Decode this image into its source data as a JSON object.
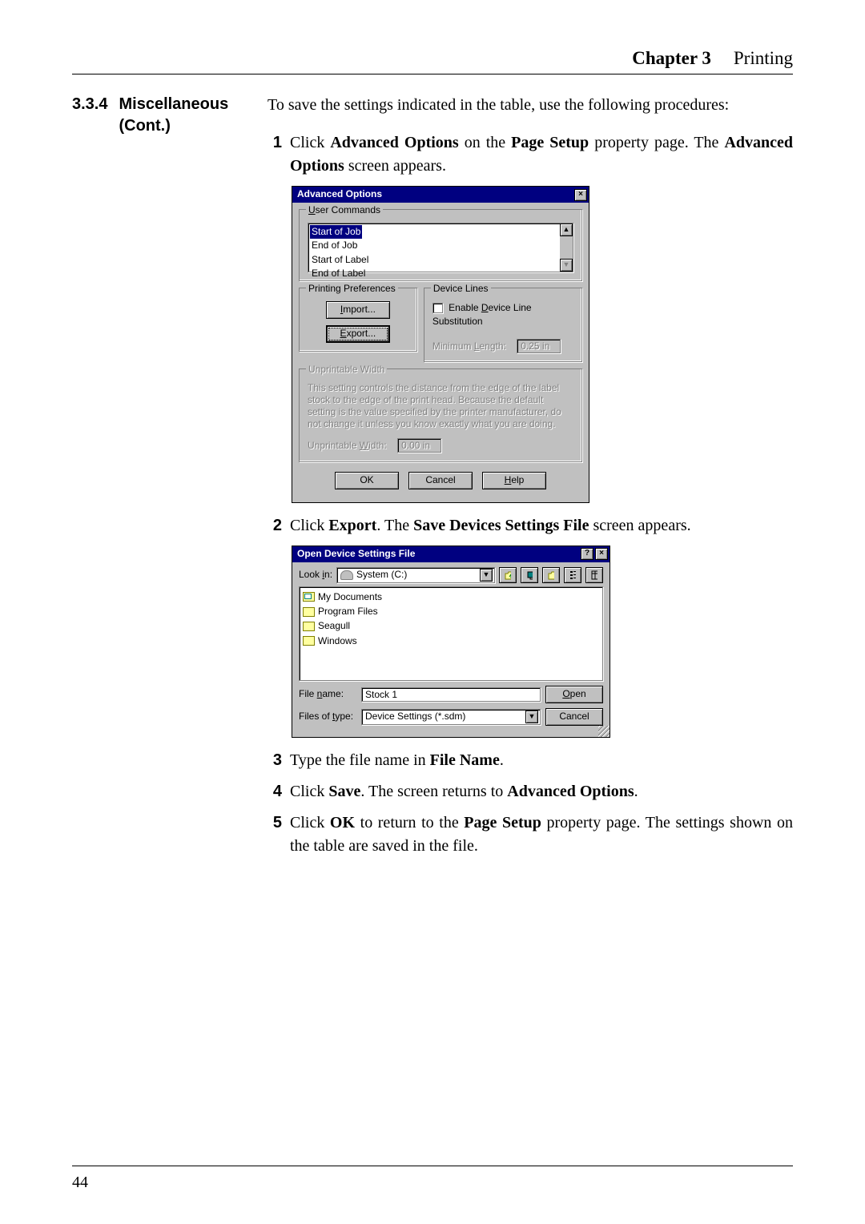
{
  "header": {
    "chapter": "Chapter 3",
    "title": "Printing"
  },
  "section": {
    "num": "3.3.4",
    "title": "Miscellaneous (Cont.)"
  },
  "intro": "To save the settings indicated in the table, use the following procedures:",
  "steps": {
    "s1": {
      "num": "1",
      "pre": "Click ",
      "b1": "Advanced Options",
      "mid": " on the ",
      "b2": "Page Setup",
      "post": " property page.  The ",
      "b3": "Advanced Options",
      "end": " screen appears."
    },
    "s2": {
      "num": "2",
      "pre": "Click ",
      "b1": "Export",
      "mid": ".  The ",
      "b2": "Save Devices Settings File",
      "end": " screen appears."
    },
    "s3": {
      "num": "3",
      "pre": "Type the file name in ",
      "b1": "File Name",
      "end": "."
    },
    "s4": {
      "num": "4",
      "pre": "Click ",
      "b1": "Save",
      "mid": ".  The screen returns to ",
      "b2": "Advanced Options",
      "end": "."
    },
    "s5": {
      "num": "5",
      "pre": "Click ",
      "b1": "OK",
      "mid": " to return to the ",
      "b2": "Page Setup",
      "end": " property page. The settings shown on the table are saved in the file."
    }
  },
  "dlg1": {
    "title": "Advanced Options",
    "close": "×",
    "grp_user": "User Commands",
    "list": {
      "sel": "Start of Job",
      "i2": "End of Job",
      "i3": "Start of Label",
      "i4": "End of Label"
    },
    "scroll_up": "▲",
    "scroll_dn": "▼",
    "grp_pref": "Printing Preferences",
    "btn_import": "Import...",
    "btn_export": "Export...",
    "grp_dev": "Device Lines",
    "chk_enable": "Enable Device Line Substitution",
    "min_len_lbl": "Minimum Length:",
    "min_len_val": "0.25 in",
    "grp_unprint": "Unprintable Width",
    "unprint_desc": "This setting controls the distance from the edge of the label stock to the edge of the print head.  Because the default setting is the value specified by the printer manufacturer, do not change it unless you know exactly what you are doing.",
    "unprint_lbl": "Unprintable Width:",
    "unprint_val": "0.00 in",
    "ok": "OK",
    "cancel": "Cancel",
    "help": "Help"
  },
  "dlg2": {
    "title": "Open Device Settings File",
    "help": "?",
    "close": "×",
    "lookin_lbl": "Look in:",
    "lookin_val": "System (C:)",
    "items": {
      "i1": "My Documents",
      "i2": "Program Files",
      "i3": "Seagull",
      "i4": "Windows"
    },
    "filename_lbl": "File name:",
    "filename_val": "Stock 1",
    "filetype_lbl": "Files of type:",
    "filetype_val": "Device Settings (*.sdm)",
    "open": "Open",
    "cancel": "Cancel",
    "drop": "▼"
  },
  "pageno": "44"
}
